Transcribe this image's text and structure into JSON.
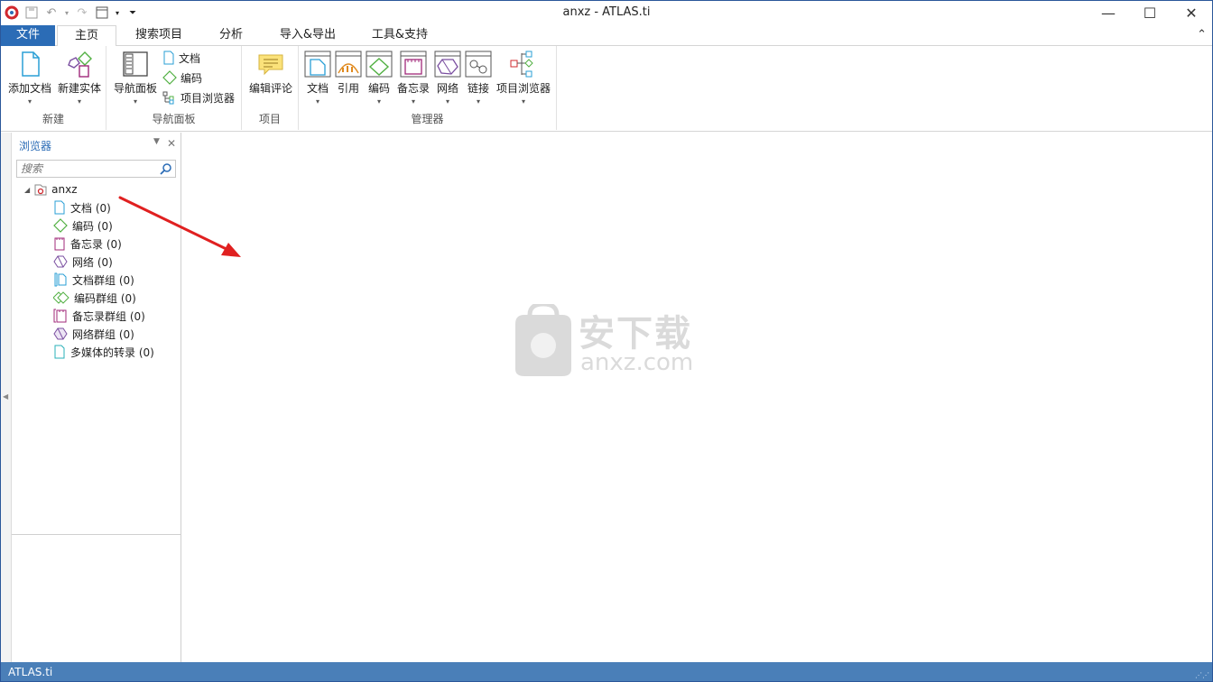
{
  "window": {
    "title": "anxz - ATLAS.ti",
    "minimize_icon": "minimize-icon",
    "maximize_icon": "maximize-icon",
    "close_icon": "close-icon"
  },
  "ribbon_tabs": [
    {
      "label": "文件"
    },
    {
      "label": "主页"
    },
    {
      "label": "搜索项目"
    },
    {
      "label": "分析"
    },
    {
      "label": "导入&导出"
    },
    {
      "label": "工具&支持"
    }
  ],
  "ribbon": {
    "groups": [
      {
        "label": "新建"
      },
      {
        "label": "导航面板"
      },
      {
        "label": "项目"
      },
      {
        "label": "管理器"
      }
    ],
    "new": {
      "add_document": "添加文档",
      "new_entity": "新建实体"
    },
    "nav": {
      "nav_panel": "导航面板",
      "documents": "文档",
      "codes": "编码",
      "project_browser": "项目浏览器"
    },
    "project": {
      "edit_comment": "编辑评论"
    },
    "managers": {
      "documents": "文档",
      "quotations": "引用",
      "codes": "编码",
      "memos": "备忘录",
      "networks": "网络",
      "links": "链接",
      "project_browser": "项目浏览器"
    }
  },
  "browser": {
    "title": "浏览器",
    "search_placeholder": "搜索",
    "root": "anxz",
    "items": [
      {
        "label": "文档 (0)",
        "icon": "document-icon"
      },
      {
        "label": "编码 (0)",
        "icon": "code-icon"
      },
      {
        "label": "备忘录 (0)",
        "icon": "memo-icon"
      },
      {
        "label": "网络 (0)",
        "icon": "network-icon"
      },
      {
        "label": "文档群组 (0)",
        "icon": "document-group-icon"
      },
      {
        "label": "编码群组 (0)",
        "icon": "code-group-icon"
      },
      {
        "label": "备忘录群组 (0)",
        "icon": "memo-group-icon"
      },
      {
        "label": "网络群组 (0)",
        "icon": "network-group-icon"
      },
      {
        "label": "多媒体的转录 (0)",
        "icon": "multimedia-transcript-icon"
      }
    ]
  },
  "watermark": {
    "line1": "安下载",
    "line2": "anxz.com"
  },
  "status": {
    "text": "ATLAS.ti"
  },
  "colors": {
    "accent": "#2b6cb6",
    "status_bar": "#4a7fb8",
    "annotation_arrow": "#e02020"
  }
}
